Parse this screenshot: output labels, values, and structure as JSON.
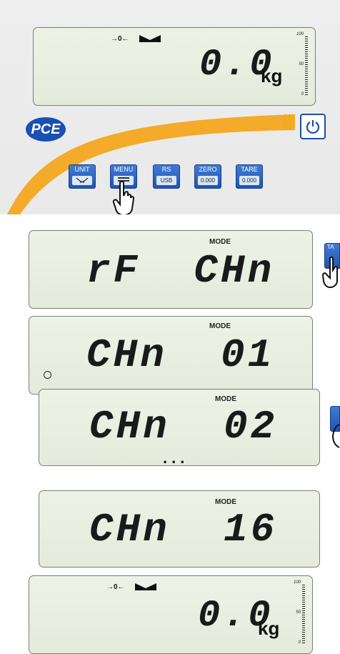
{
  "top_panel": {
    "display": {
      "stable_indicator": "→0←",
      "reading": "0.0",
      "unit": "kg",
      "bargraph": {
        "top": "100",
        "mid": "50",
        "bottom": "0"
      }
    },
    "logo": "PCE",
    "keys": [
      {
        "label": "UNIT",
        "face": ""
      },
      {
        "label": "MENU",
        "face": ""
      },
      {
        "label": "RS",
        "face": "USB"
      },
      {
        "label": "ZERO",
        "face": "0.000"
      },
      {
        "label": "TARE",
        "face": "0.000"
      }
    ]
  },
  "screens": [
    {
      "mode": "MODE",
      "reading": "rF  CHn"
    },
    {
      "mode": "MODE",
      "reading": "CHn  01"
    },
    {
      "mode": "MODE",
      "reading": "CHn  02"
    },
    {
      "mode": "MODE",
      "reading": "CHn  16"
    }
  ],
  "ellipsis": "...",
  "side_key": {
    "label": "TA"
  },
  "bottom_display": {
    "stable_indicator": "→0←",
    "reading": "0.0",
    "unit": "kg",
    "bargraph": {
      "top": "100",
      "mid": "50",
      "bottom": "0"
    }
  },
  "colors": {
    "key_blue": "#2a64c2",
    "swoosh_orange": "#f3a81f",
    "lcd_bg": "#e8eee0"
  }
}
